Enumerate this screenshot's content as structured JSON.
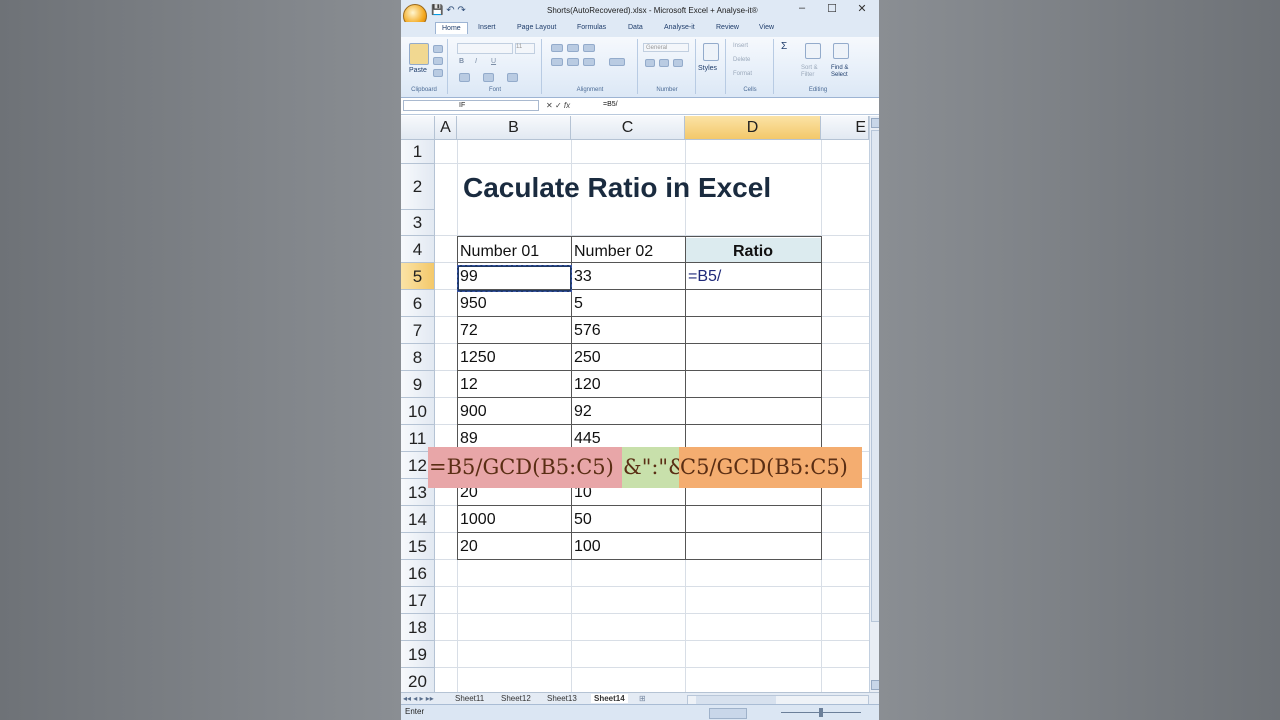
{
  "window": {
    "title": "Shorts(AutoRecovered).xlsx - Microsoft Excel + Analyse-it®",
    "controls": [
      "–",
      "☐",
      "✕"
    ]
  },
  "ribbon": {
    "tabs": [
      "Home",
      "Insert",
      "Page Layout",
      "Formulas",
      "Data",
      "Analyse-it",
      "Review",
      "View"
    ],
    "active_tab": "Home",
    "groups": [
      "Clipboard",
      "Font",
      "Alignment",
      "Number",
      "Styles",
      "Cells",
      "Editing"
    ],
    "paste_label": "Paste",
    "styles_label": "Styles",
    "number_format": "General",
    "font_size": "11",
    "cells_items": [
      "Insert",
      "Delete",
      "Format"
    ],
    "editing_items": [
      "Sort &\nFilter",
      "Find &\nSelect"
    ]
  },
  "formula_bar": {
    "name_box": "IF",
    "fx": "fx",
    "value": "=B5/"
  },
  "columns": [
    "A",
    "B",
    "C",
    "D",
    "E"
  ],
  "rows": [
    "1",
    "2",
    "3",
    "4",
    "5",
    "6",
    "7",
    "8",
    "9",
    "10",
    "11",
    "12",
    "13",
    "14",
    "15",
    "16",
    "17",
    "18",
    "19",
    "20"
  ],
  "sheet": {
    "title": "Caculate Ratio in Excel",
    "headers": [
      "Number 01",
      "Number 02",
      "Ratio"
    ],
    "data": [
      [
        "99",
        "33",
        "=B5/"
      ],
      [
        "950",
        "5",
        ""
      ],
      [
        "72",
        "576",
        ""
      ],
      [
        "1250",
        "250",
        ""
      ],
      [
        "12",
        "120",
        ""
      ],
      [
        "900",
        "92",
        ""
      ],
      [
        "89",
        "445",
        ""
      ],
      [
        "",
        "",
        ""
      ],
      [
        "20",
        "10",
        ""
      ],
      [
        "1000",
        "50",
        ""
      ],
      [
        "20",
        "100",
        ""
      ]
    ]
  },
  "overlay": {
    "part1": "=B5/GCD(B5:C5)",
    "part2": "&\":\"&",
    "part3": "C5/GCD(B5:C5)"
  },
  "sheet_tabs": [
    "Sheet11",
    "Sheet12",
    "Sheet13",
    "Sheet14"
  ],
  "active_sheet": "Sheet14",
  "status": {
    "mode": "Enter"
  },
  "colors": {
    "selected_header": "#f3c86a",
    "ratio_header_bg": "#dcebef",
    "overlay_red": "#e8a6a8",
    "overlay_green": "#c8e0ab",
    "overlay_orange": "#f4ad70"
  }
}
